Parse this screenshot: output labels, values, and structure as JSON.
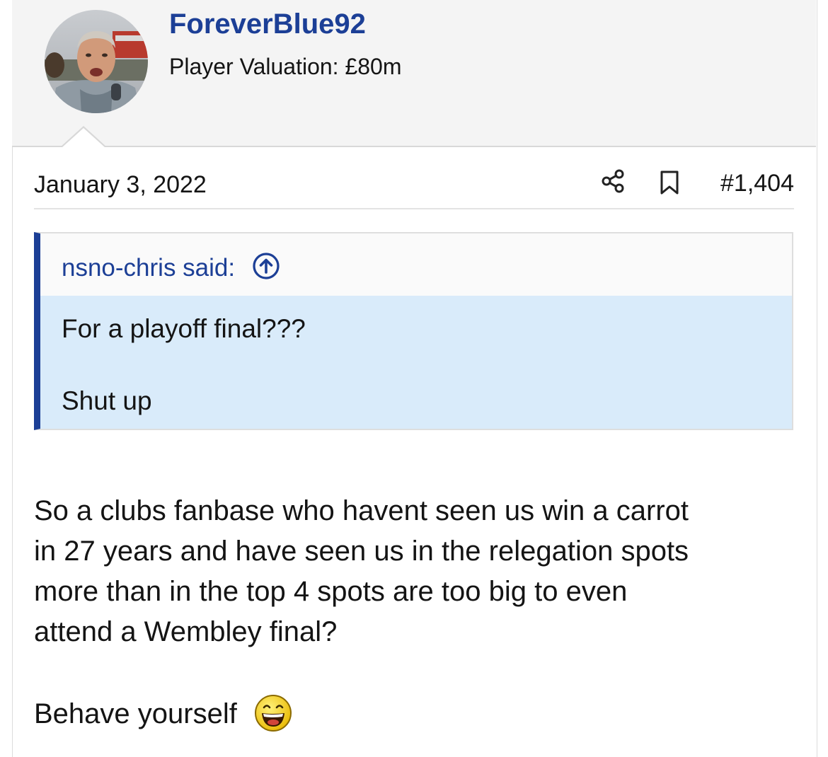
{
  "post": {
    "author": {
      "username": "ForeverBlue92",
      "title": "Player Valuation: £80m",
      "avatar_icon": "user-avatar-photo"
    },
    "date": "January 3, 2022",
    "actions": {
      "share_icon": "share-icon",
      "bookmark_icon": "bookmark-icon",
      "post_number": "#1,404"
    },
    "quote": {
      "author_label": "nsno-chris said:",
      "jump_icon": "arrow-up-circle-icon",
      "lines": [
        "For a playoff final???",
        "Shut up"
      ]
    },
    "message": {
      "lines": [
        "So a clubs fanbase who havent seen us win a carrot",
        "in 27 years and have seen us in the relegation spots",
        "more than in the top 4 spots are too big to even",
        "attend a Wembley final?"
      ],
      "closing": "Behave yourself",
      "emoji_icon": "laughing-smiley-icon"
    },
    "colors": {
      "link": "#1c3f96",
      "quote_bar": "#1c3f96",
      "quote_background": "#d9ebfa",
      "header_background": "#f4f4f4"
    }
  }
}
